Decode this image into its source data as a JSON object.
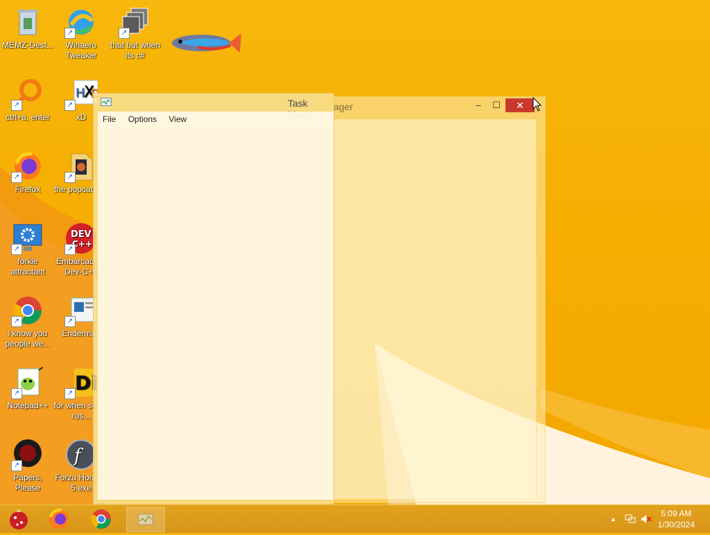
{
  "desktop": {
    "icons": [
      {
        "label": "MEMZ-Dest..."
      },
      {
        "label": "Winaero Tweaker"
      },
      {
        "label": "that but when its c#"
      },
      {
        "label": "ctrl+a, enter"
      },
      {
        "label": "xD"
      },
      {
        "label": "Firefox"
      },
      {
        "label": "the popcat shit"
      },
      {
        "label": "forkie attractant"
      },
      {
        "label": "Embarcadero Dev-C++"
      },
      {
        "label": "i know you people we..."
      },
      {
        "label": "Enderman"
      },
      {
        "label": "Notepad++"
      },
      {
        "label": "for when some rus..."
      },
      {
        "label": "Papers, Please"
      },
      {
        "label": "Forza Horizon 5.exe"
      }
    ]
  },
  "task_manager_front": {
    "title": "Task Mana",
    "menu": [
      "File",
      "Options",
      "View"
    ]
  },
  "task_manager_back": {
    "title": "ager",
    "minimize": "–",
    "maximize": "☐",
    "close": "✕"
  },
  "taskbar": {
    "time": "5:09 AM",
    "date": "1/30/2024",
    "tray_chevron": "▲"
  },
  "colors": {
    "desktop": "#f6ad00",
    "taskbar": "#dc9a1b",
    "close_button": "#c8392d"
  }
}
